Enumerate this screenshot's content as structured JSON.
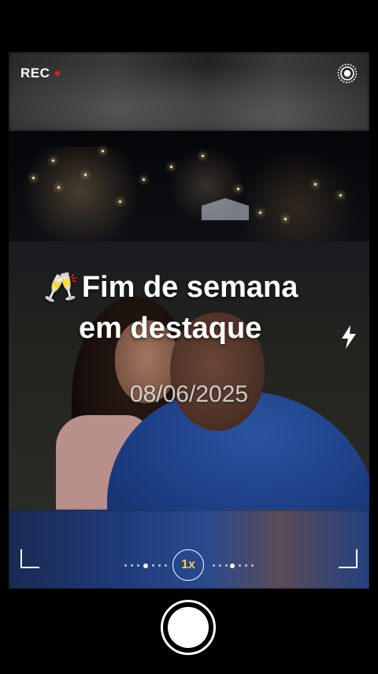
{
  "status": {
    "rec_label": "REC",
    "rec_dot_color": "#e02020"
  },
  "overlay": {
    "title_emoji": "🥂",
    "title_line1": "Fim de semana",
    "title_line2": "em destaque",
    "date": "08/06/2025"
  },
  "controls": {
    "zoom_label": "1x",
    "zoom_color": "#f5d04a",
    "settings_icon": "settings-ring-icon",
    "flash_icon": "flash-icon",
    "shutter": "shutter-button"
  }
}
